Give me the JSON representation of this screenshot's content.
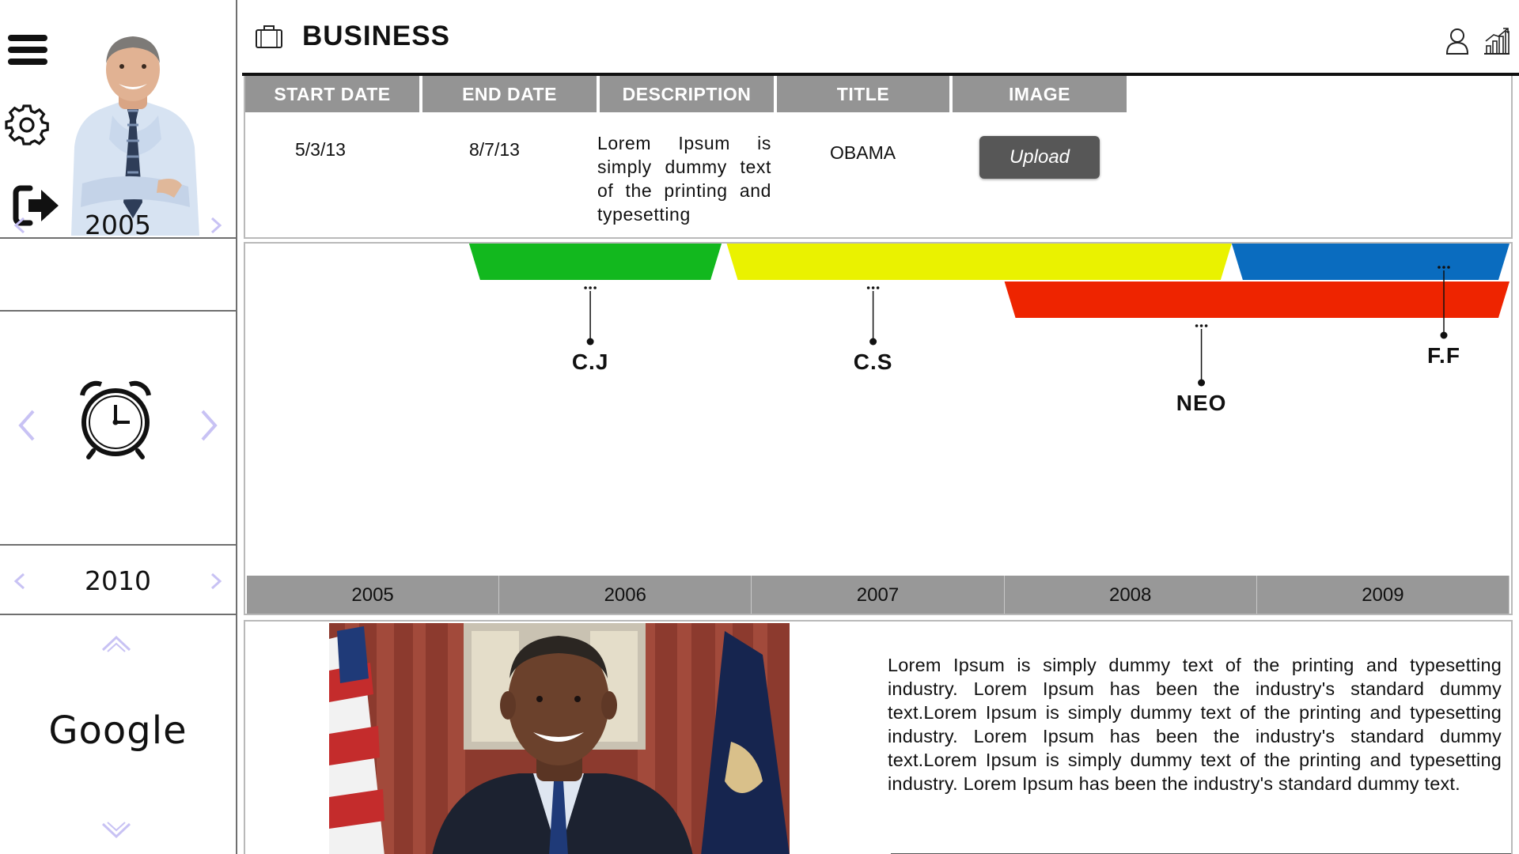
{
  "header": {
    "title": "BUSINESS",
    "icons": [
      "briefcase-icon",
      "user-icon",
      "stats-icon"
    ]
  },
  "sidebar": {
    "icons": [
      "menu-icon",
      "gear-icon",
      "logout-icon"
    ],
    "start_year": "2005",
    "end_year": "2010",
    "clock_icon": "alarm-clock-icon",
    "search_provider": "Google"
  },
  "table": {
    "columns": [
      "START DATE",
      "END DATE",
      "DESCRIPTION",
      "TITLE",
      "IMAGE"
    ],
    "row": {
      "start_date": "5/3/13",
      "end_date": "8/7/13",
      "description": "Lorem Ipsum is simply dummy text of the printing and typesetting",
      "title": "OBAMA",
      "upload_label": "Upload"
    }
  },
  "timeline": {
    "years": [
      "2005",
      "2006",
      "2007",
      "2008",
      "2009"
    ],
    "bands": [
      {
        "color": "#12b81e",
        "start": 2005.88,
        "end": 2006.88
      },
      {
        "color": "#eaf200",
        "start": 2006.9,
        "end": 2008.9
      },
      {
        "color": "#0a6cbf",
        "start": 2008.9,
        "end": 2010.0
      },
      {
        "color": "#ee2400",
        "start": 2008.0,
        "end": 2010.0
      }
    ],
    "markers": [
      {
        "label": "C.J",
        "year": 2006.36
      },
      {
        "label": "C.S",
        "year": 2007.48
      },
      {
        "label": "NEO",
        "year": 2008.78
      },
      {
        "label": "F.F",
        "year": 2009.74
      }
    ]
  },
  "detail": {
    "text": "Lorem Ipsum is simply dummy text of the printing and typesetting industry. Lorem Ipsum has been the industry's standard dummy text.Lorem Ipsum is simply dummy text of the printing and typesetting industry. Lorem Ipsum has been the industry's standard dummy text.Lorem Ipsum is simply dummy text of the printing and typesetting industry. Lorem Ipsum has been the industry's standard dummy text."
  }
}
